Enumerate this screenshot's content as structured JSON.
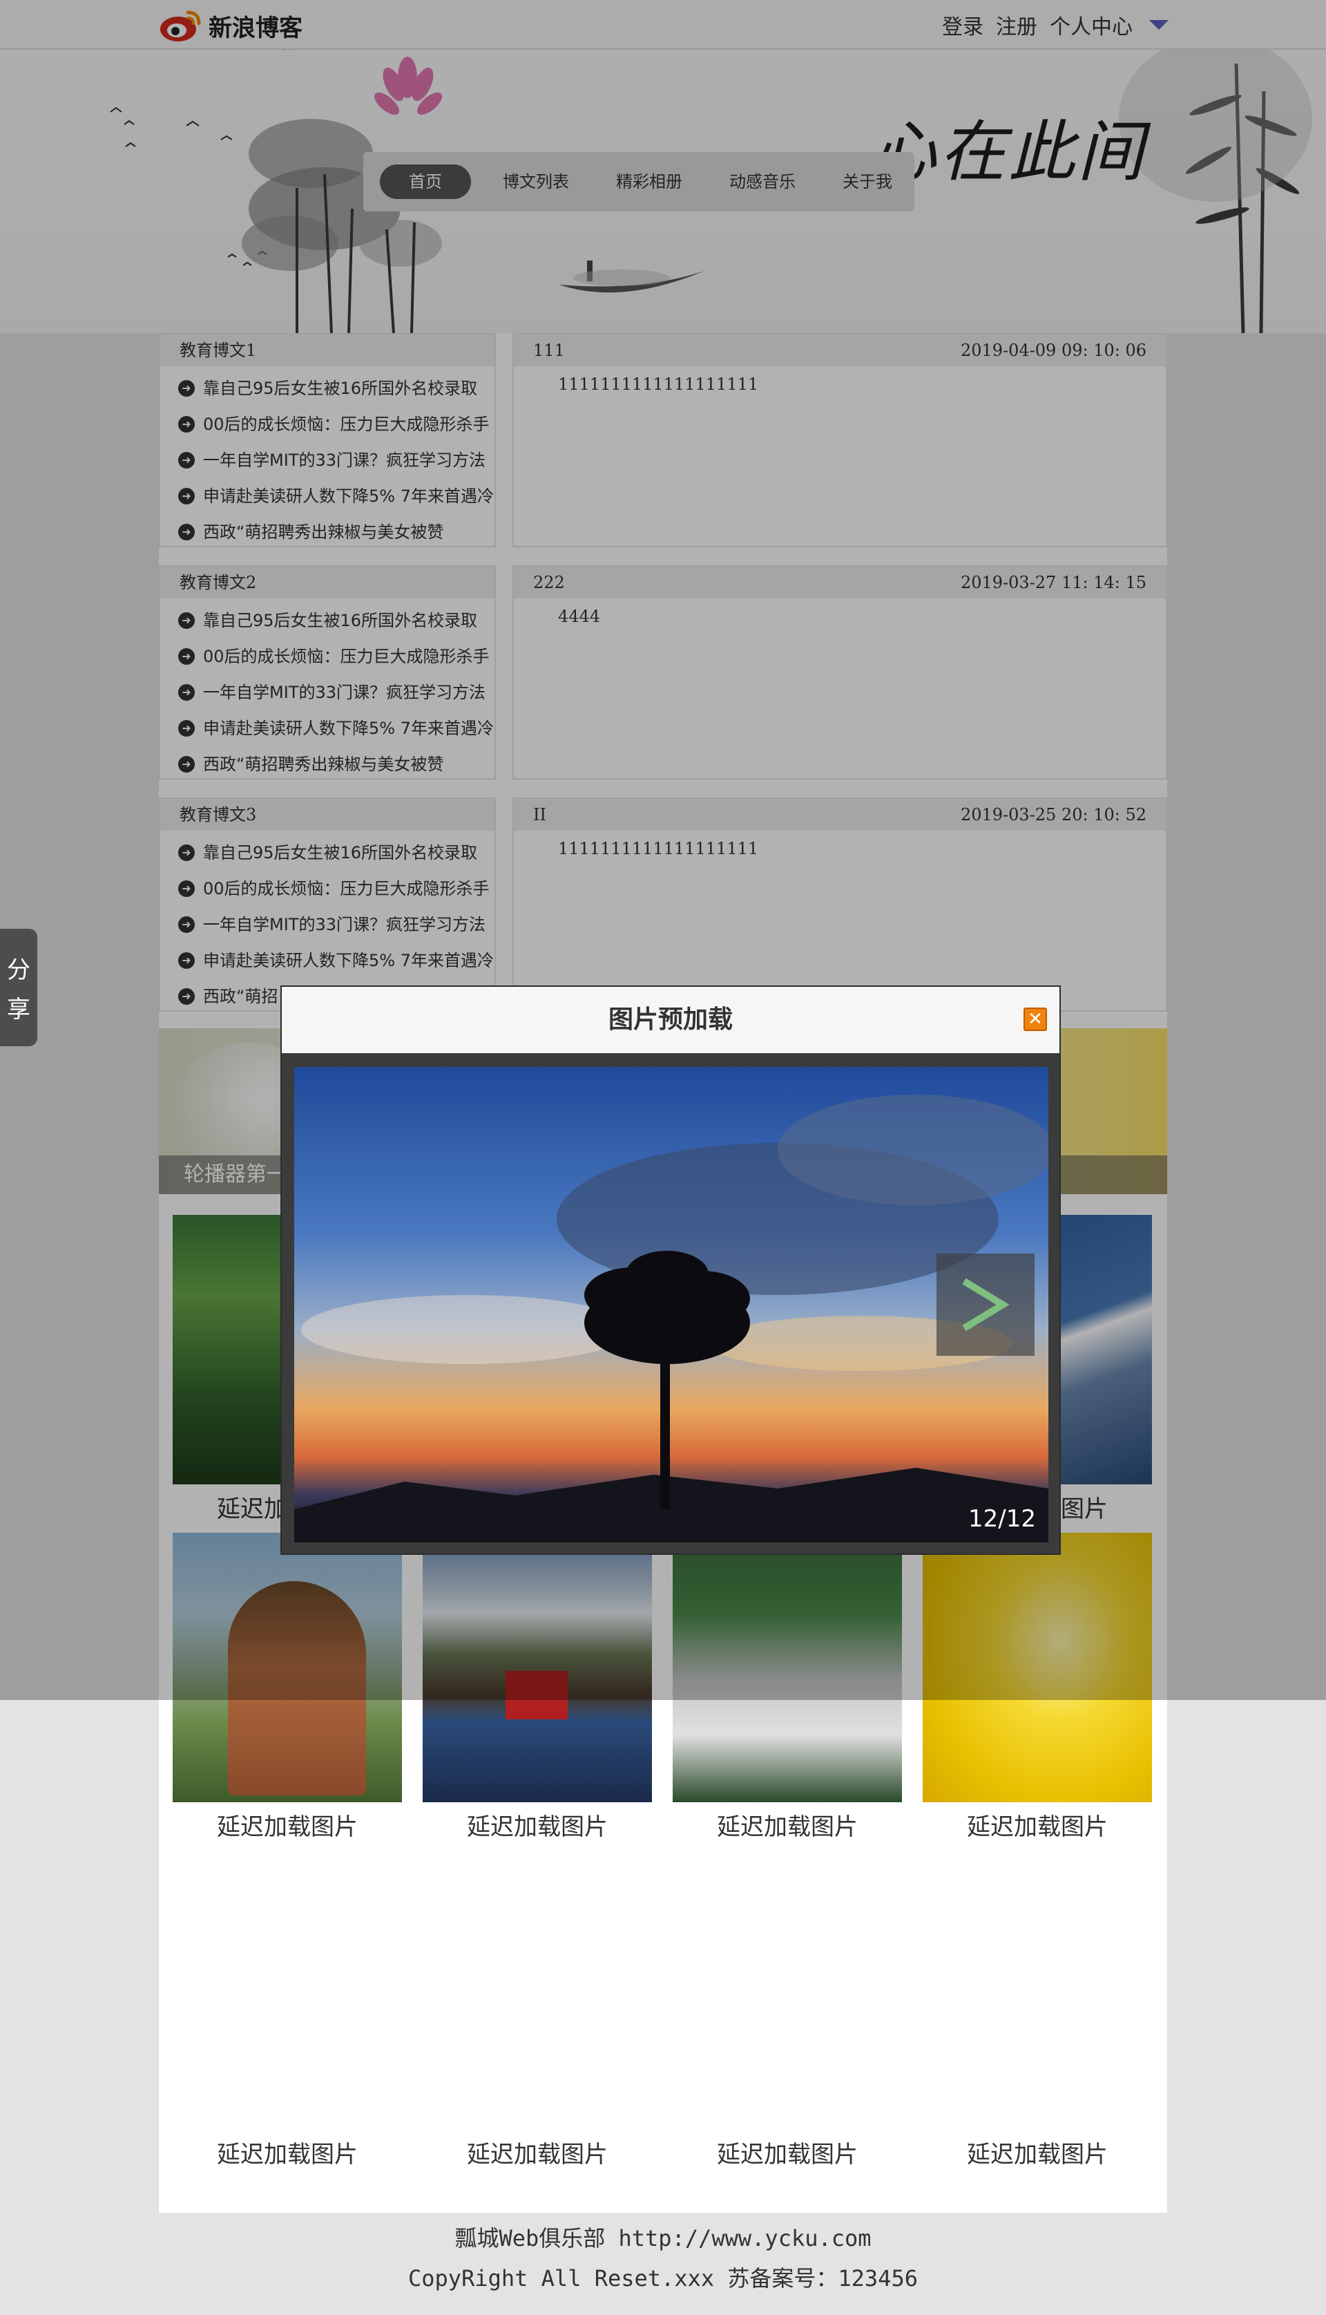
{
  "topbar": {
    "logo_text": "新浪博客",
    "links": [
      "登录",
      "注册",
      "个人中心"
    ]
  },
  "header": {
    "calligraphy": "心在此间",
    "nav": [
      {
        "label": "首页",
        "active": true
      },
      {
        "label": "博文列表",
        "active": false
      },
      {
        "label": "精彩相册",
        "active": false
      },
      {
        "label": "动感音乐",
        "active": false
      },
      {
        "label": "关于我",
        "active": false
      }
    ]
  },
  "sections": [
    {
      "category": "教育博文1",
      "news": [
        "靠自己95后女生被16所国外名校录取",
        "00后的成长烦恼：压力巨大成隐形杀手",
        "一年自学MIT的33门课？疯狂学习方法",
        "申请赴美读研人数下降5% 7年来首遇冷",
        "西政“萌招聘秀出辣椒与美女被赞"
      ],
      "post": {
        "title": "111",
        "date": "2019-04-09 09: 10: 06",
        "body": "1111111111111111111"
      }
    },
    {
      "category": "教育博文2",
      "news": [
        "靠自己95后女生被16所国外名校录取",
        "00后的成长烦恼：压力巨大成隐形杀手",
        "一年自学MIT的33门课？疯狂学习方法",
        "申请赴美读研人数下降5% 7年来首遇冷",
        "西政“萌招聘秀出辣椒与美女被赞"
      ],
      "post": {
        "title": "222",
        "date": "2019-03-27 11: 14: 15",
        "body": "4444"
      }
    },
    {
      "category": "教育博文3",
      "news": [
        "靠自己95后女生被16所国外名校录取",
        "00后的成长烦恼：压力巨大成隐形杀手",
        "一年自学MIT的33门课？疯狂学习方法",
        "申请赴美读研人数下降5% 7年来首遇冷",
        "西政“萌招"
      ],
      "post": {
        "title": "II",
        "date": "2019-03-25 20: 10: 52",
        "body": "1111111111111111111"
      }
    }
  ],
  "carousel": {
    "caption": "轮播器第一"
  },
  "gallery": {
    "label": "延迟加载图片",
    "count": 12
  },
  "share": {
    "chars": [
      "分",
      "享"
    ]
  },
  "modal": {
    "title": "图片预加载",
    "close_glyph": "✕",
    "counter": "12/12"
  },
  "footer": {
    "line1": "瓢城Web俱乐部 http://www.ycku.com",
    "line2": "CopyRight All Reset.xxx 苏备案号：123456"
  },
  "colors": {
    "nav_active": "#555555",
    "accent_caret": "#5a62c0",
    "close_button": "#f0820f",
    "overlay": "rgba(0,0,0,0.30)"
  }
}
